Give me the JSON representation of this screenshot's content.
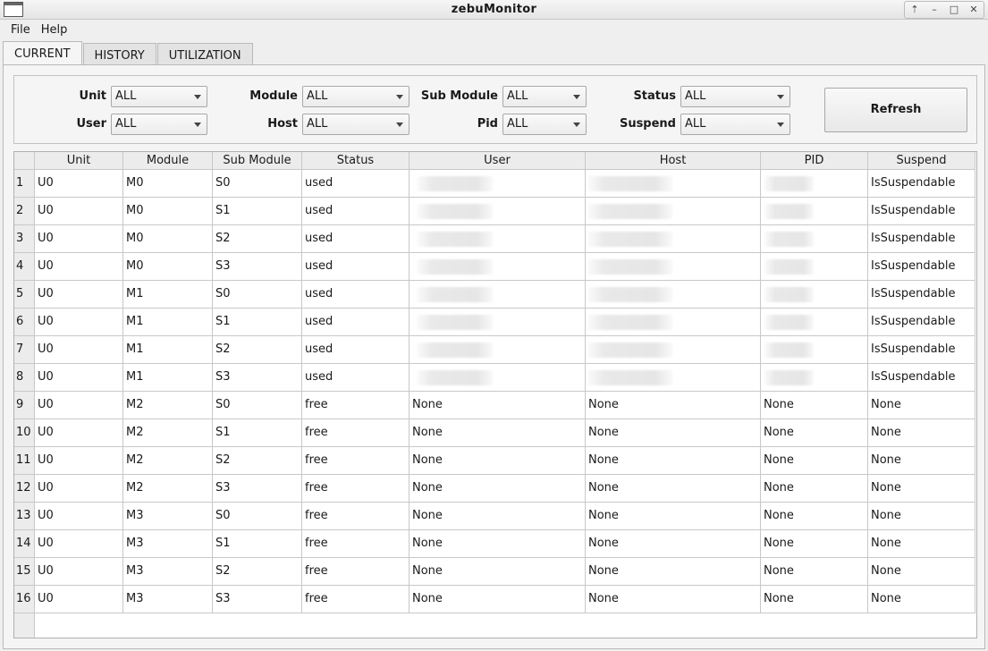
{
  "window": {
    "title": "zebuMonitor",
    "controls": [
      "up-icon",
      "minimize-icon",
      "maximize-icon",
      "close-icon"
    ]
  },
  "menu": {
    "file": "File",
    "help": "Help"
  },
  "tabs": [
    {
      "label": "CURRENT",
      "active": true
    },
    {
      "label": "HISTORY",
      "active": false
    },
    {
      "label": "UTILIZATION",
      "active": false
    }
  ],
  "filters": {
    "unit": {
      "label": "Unit",
      "value": "ALL"
    },
    "user": {
      "label": "User",
      "value": "ALL"
    },
    "module": {
      "label": "Module",
      "value": "ALL"
    },
    "host": {
      "label": "Host",
      "value": "ALL"
    },
    "submodule": {
      "label": "Sub Module",
      "value": "ALL"
    },
    "pid": {
      "label": "Pid",
      "value": "ALL"
    },
    "status": {
      "label": "Status",
      "value": "ALL"
    },
    "suspend": {
      "label": "Suspend",
      "value": "ALL"
    },
    "refresh_label": "Refresh"
  },
  "table": {
    "columns": [
      "Unit",
      "Module",
      "Sub Module",
      "Status",
      "User",
      "Host",
      "PID",
      "Suspend"
    ],
    "rows": [
      [
        "1",
        "U0",
        "M0",
        "S0",
        "used",
        "",
        "",
        "",
        "IsSuspendable"
      ],
      [
        "2",
        "U0",
        "M0",
        "S1",
        "used",
        "",
        "",
        "",
        "IsSuspendable"
      ],
      [
        "3",
        "U0",
        "M0",
        "S2",
        "used",
        "",
        "",
        "",
        "IsSuspendable"
      ],
      [
        "4",
        "U0",
        "M0",
        "S3",
        "used",
        "",
        "",
        "",
        "IsSuspendable"
      ],
      [
        "5",
        "U0",
        "M1",
        "S0",
        "used",
        "",
        "",
        "",
        "IsSuspendable"
      ],
      [
        "6",
        "U0",
        "M1",
        "S1",
        "used",
        "",
        "",
        "",
        "IsSuspendable"
      ],
      [
        "7",
        "U0",
        "M1",
        "S2",
        "used",
        "",
        "",
        "",
        "IsSuspendable"
      ],
      [
        "8",
        "U0",
        "M1",
        "S3",
        "used",
        "",
        "",
        "",
        "IsSuspendable"
      ],
      [
        "9",
        "U0",
        "M2",
        "S0",
        "free",
        "None",
        "None",
        "None",
        "None"
      ],
      [
        "10",
        "U0",
        "M2",
        "S1",
        "free",
        "None",
        "None",
        "None",
        "None"
      ],
      [
        "11",
        "U0",
        "M2",
        "S2",
        "free",
        "None",
        "None",
        "None",
        "None"
      ],
      [
        "12",
        "U0",
        "M2",
        "S3",
        "free",
        "None",
        "None",
        "None",
        "None"
      ],
      [
        "13",
        "U0",
        "M3",
        "S0",
        "free",
        "None",
        "None",
        "None",
        "None"
      ],
      [
        "14",
        "U0",
        "M3",
        "S1",
        "free",
        "None",
        "None",
        "None",
        "None"
      ],
      [
        "15",
        "U0",
        "M3",
        "S2",
        "free",
        "None",
        "None",
        "None",
        "None"
      ],
      [
        "16",
        "U0",
        "M3",
        "S3",
        "free",
        "None",
        "None",
        "None",
        "None"
      ]
    ]
  }
}
